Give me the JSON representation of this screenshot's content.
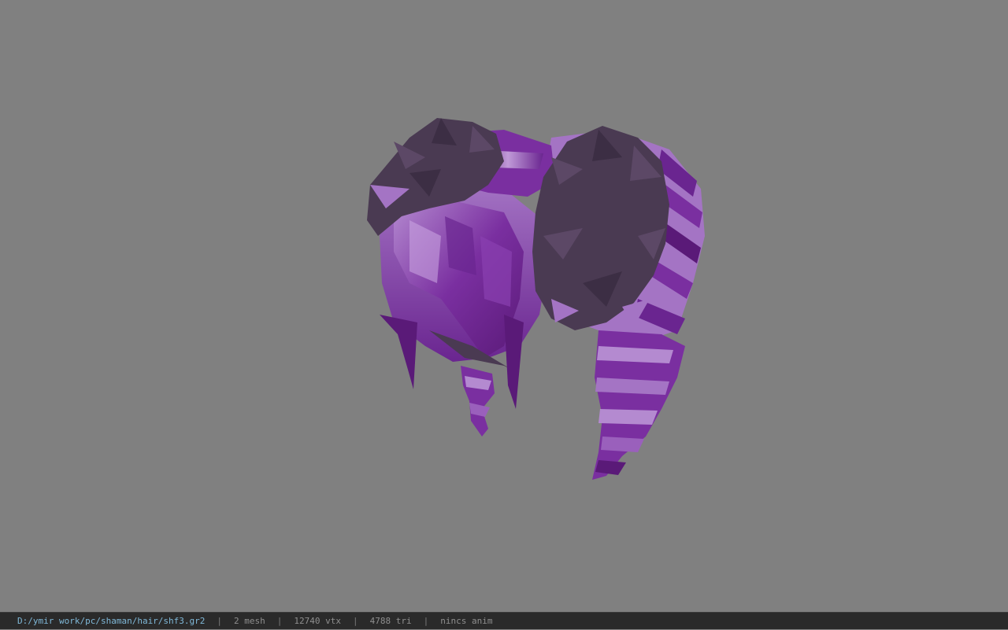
{
  "viewport": {
    "background_color": "#808080",
    "model_colors": {
      "dark_purple": "#5a1a78",
      "mid_purple": "#7a2fa0",
      "light_purple": "#a474c4",
      "pale_purple": "#b48ad0",
      "shadow_gray": "#4a3a52"
    }
  },
  "statusbar": {
    "file_path": "D:/ymir work/pc/shaman/hair/shf3.gr2",
    "separator": "|",
    "mesh_count": "2 mesh",
    "vertex_count": "12740 vtx",
    "triangle_count": "4788 tri",
    "anim_status": "nincs anim"
  }
}
